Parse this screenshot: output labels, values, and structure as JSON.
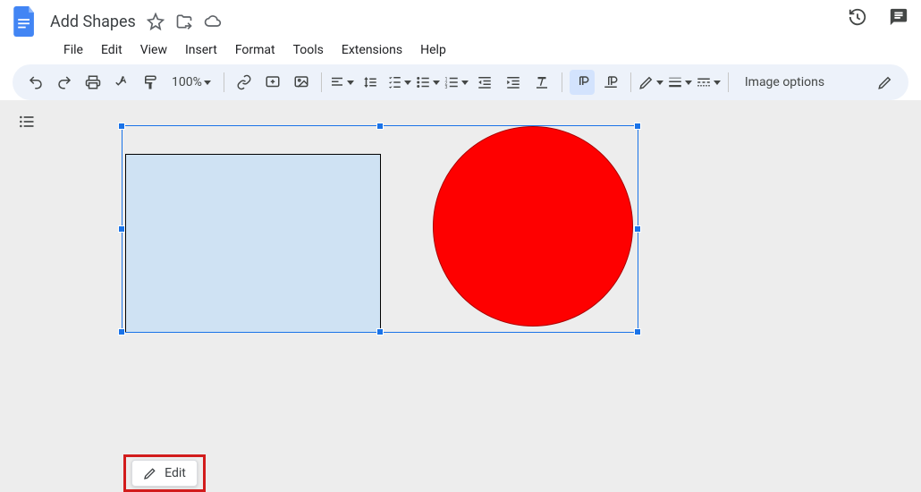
{
  "header": {
    "title": "Add Shapes"
  },
  "menus": [
    "File",
    "Edit",
    "View",
    "Insert",
    "Format",
    "Tools",
    "Extensions",
    "Help"
  ],
  "toolbar": {
    "zoom": "100%",
    "image_options": "Image options"
  },
  "contextual": {
    "edit": "Edit"
  }
}
